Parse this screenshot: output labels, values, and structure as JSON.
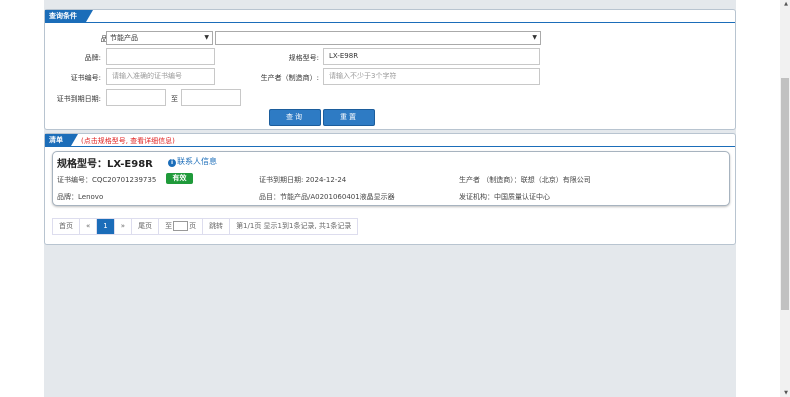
{
  "query": {
    "tab_label": "查询条件",
    "category_label": "品目:",
    "category_value": "节能产品",
    "subcategory_value": "",
    "brand_label": "品牌:",
    "brand_value": "",
    "model_label": "规格型号:",
    "model_value": "LX-E98R",
    "cert_no_label": "证书编号:",
    "cert_no_placeholder": "请输入准确的证书编号",
    "manufacturer_label": "生产者（制造商）:",
    "manufacturer_placeholder": "请输入不少于3个字符",
    "expiry_label": "证书到期日期:",
    "expiry_sep": "至",
    "search_button": "查询",
    "reset_button": "重置"
  },
  "list": {
    "tab_label": "清单",
    "hint": "(点击规格型号, 查看详细信息)",
    "items": [
      {
        "model": "规格型号：LX-E98R",
        "contact": "联系人信息",
        "cert_no": "证书编号：CQC20701239735",
        "status": "有效",
        "expiry": "证书到期日期: 2024-12-24",
        "manufacturer": "生产者 （制造商）：联想（北京）有限公司",
        "brand": "品牌：Lenovo",
        "category": "品目：节能产品/A0201060401液晶显示器",
        "issuer": "发证机构：中国质量认证中心"
      }
    ]
  },
  "pager": {
    "first": "首页",
    "prev": "«",
    "current": "1",
    "next": "»",
    "last": "尾页",
    "goto_prefix": "至",
    "goto_suffix": "页",
    "goto_button": "跳转",
    "summary": "第1/1页 显示1到1条记录, 共1条记录"
  },
  "colors": {
    "accent": "#1b6db9",
    "status_valid": "#1f9a3a",
    "hint": "#e02020"
  }
}
